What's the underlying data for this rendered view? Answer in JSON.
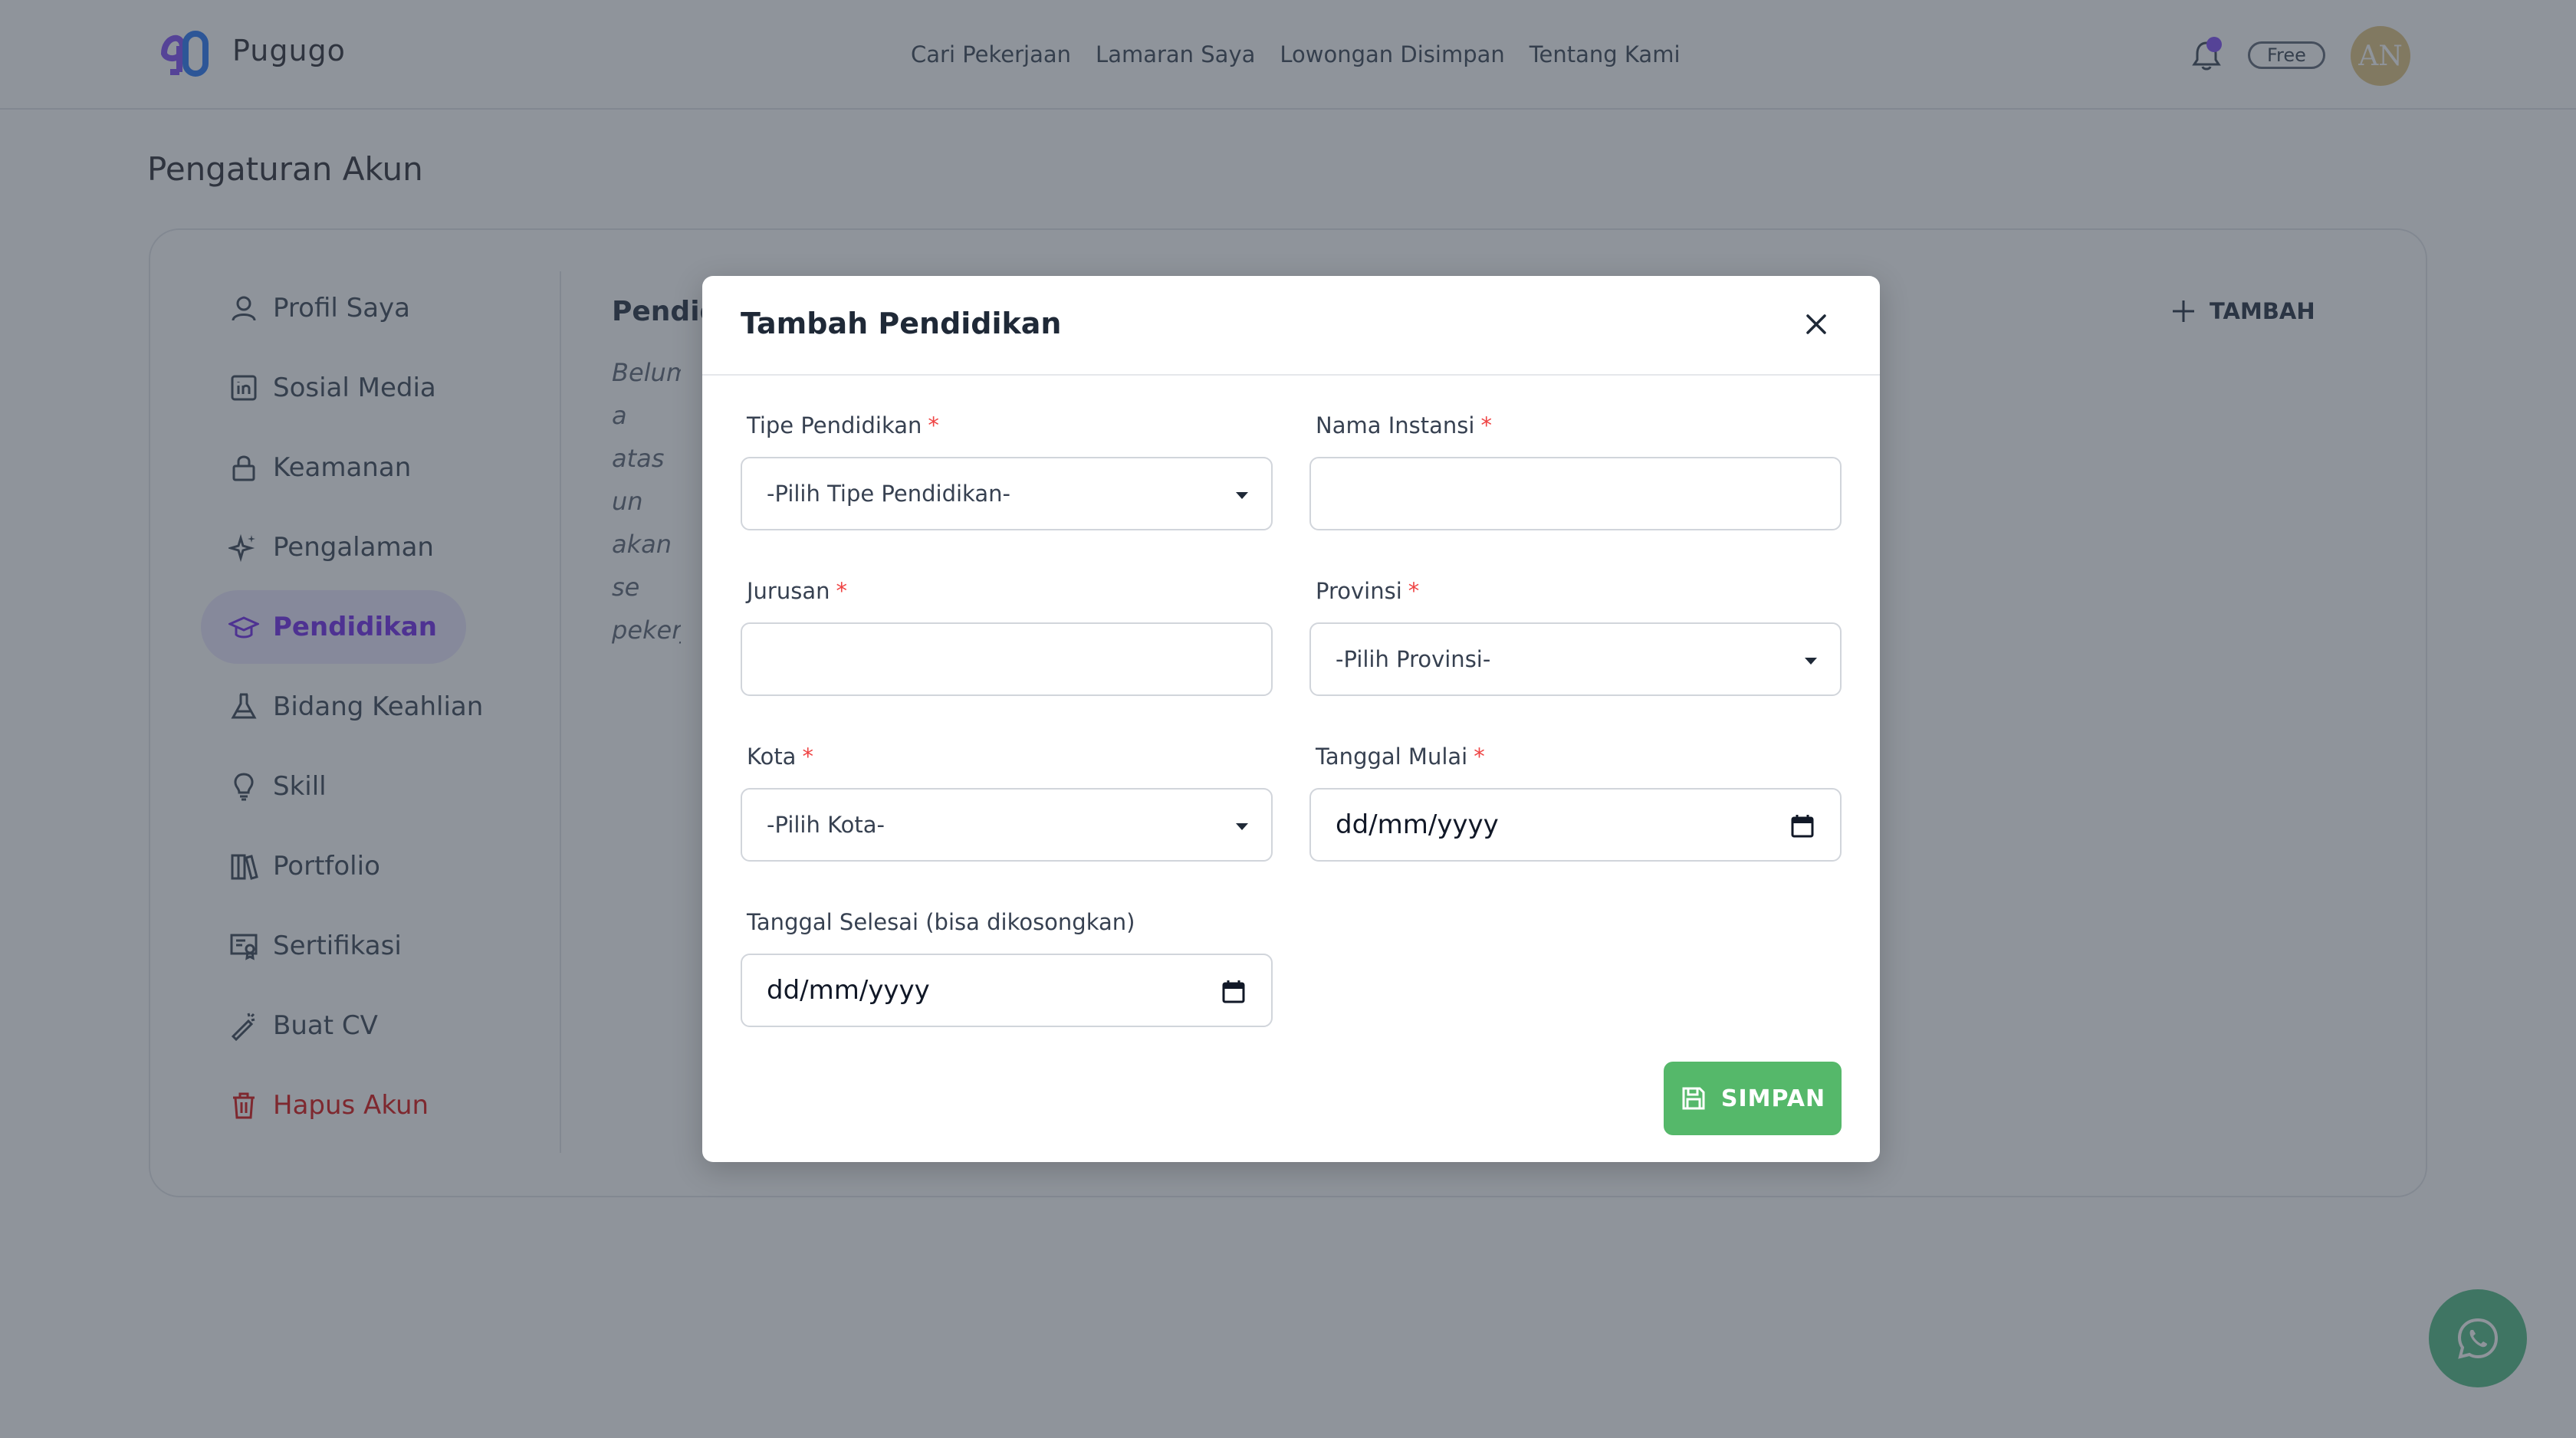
{
  "app": {
    "brand": "Pugugo",
    "logo_icon": "pugugo-logo",
    "accent": "#7c3aed"
  },
  "nav": [
    {
      "label": "Cari Pekerjaan"
    },
    {
      "label": "Lamaran Saya"
    },
    {
      "label": "Lowongan Disimpan"
    },
    {
      "label": "Tentang Kami"
    }
  ],
  "header": {
    "plan_badge": "Free",
    "avatar_initials": "AN"
  },
  "page": {
    "title": "Pengaturan Akun"
  },
  "sidebar": {
    "items": [
      {
        "label": "Profil Saya",
        "icon": "user-icon"
      },
      {
        "label": "Sosial Media",
        "icon": "linkedin-icon"
      },
      {
        "label": "Keamanan",
        "icon": "lock-icon"
      },
      {
        "label": "Pengalaman",
        "icon": "sparkle-icon"
      },
      {
        "label": "Pendidikan",
        "icon": "graduation-cap-icon",
        "active": true
      },
      {
        "label": "Bidang Keahlian",
        "icon": "flask-icon"
      },
      {
        "label": "Skill",
        "icon": "lightbulb-icon"
      },
      {
        "label": "Portfolio",
        "icon": "books-icon"
      },
      {
        "label": "Sertifikasi",
        "icon": "certificate-icon"
      },
      {
        "label": "Buat CV",
        "icon": "magic-wand-icon"
      },
      {
        "label": "Hapus Akun",
        "icon": "trash-icon",
        "danger": true
      }
    ]
  },
  "content": {
    "title": "Pendidikan",
    "empty_text_lines": [
      "Belum a",
      "atas un",
      "akan se",
      "pekerja"
    ],
    "add_label": "TAMBAH"
  },
  "modal": {
    "title": "Tambah Pendidikan",
    "fields": {
      "tipe": {
        "label": "Tipe Pendidikan",
        "required_mark": "*",
        "value": "-Pilih Tipe Pendidikan-"
      },
      "instansi": {
        "label": "Nama Instansi",
        "required_mark": "*",
        "value": ""
      },
      "jurusan": {
        "label": "Jurusan",
        "required_mark": "*",
        "value": ""
      },
      "provinsi": {
        "label": "Provinsi",
        "required_mark": "*",
        "value": "-Pilih Provinsi-"
      },
      "kota": {
        "label": "Kota",
        "required_mark": "*",
        "value": "-Pilih Kota-"
      },
      "mulai": {
        "label": "Tanggal Mulai",
        "required_mark": "*",
        "placeholder": "dd/mm/yyyy"
      },
      "selesai": {
        "label": "Tanggal Selesai (bisa dikosongkan)",
        "placeholder": "dd/mm/yyyy"
      }
    },
    "save_label": "SIMPAN"
  },
  "colors": {
    "overlay": "rgba(31,41,55,0.5)",
    "save": "#55b86a",
    "required": "#ef4444",
    "whatsapp": "#5fc08f"
  }
}
